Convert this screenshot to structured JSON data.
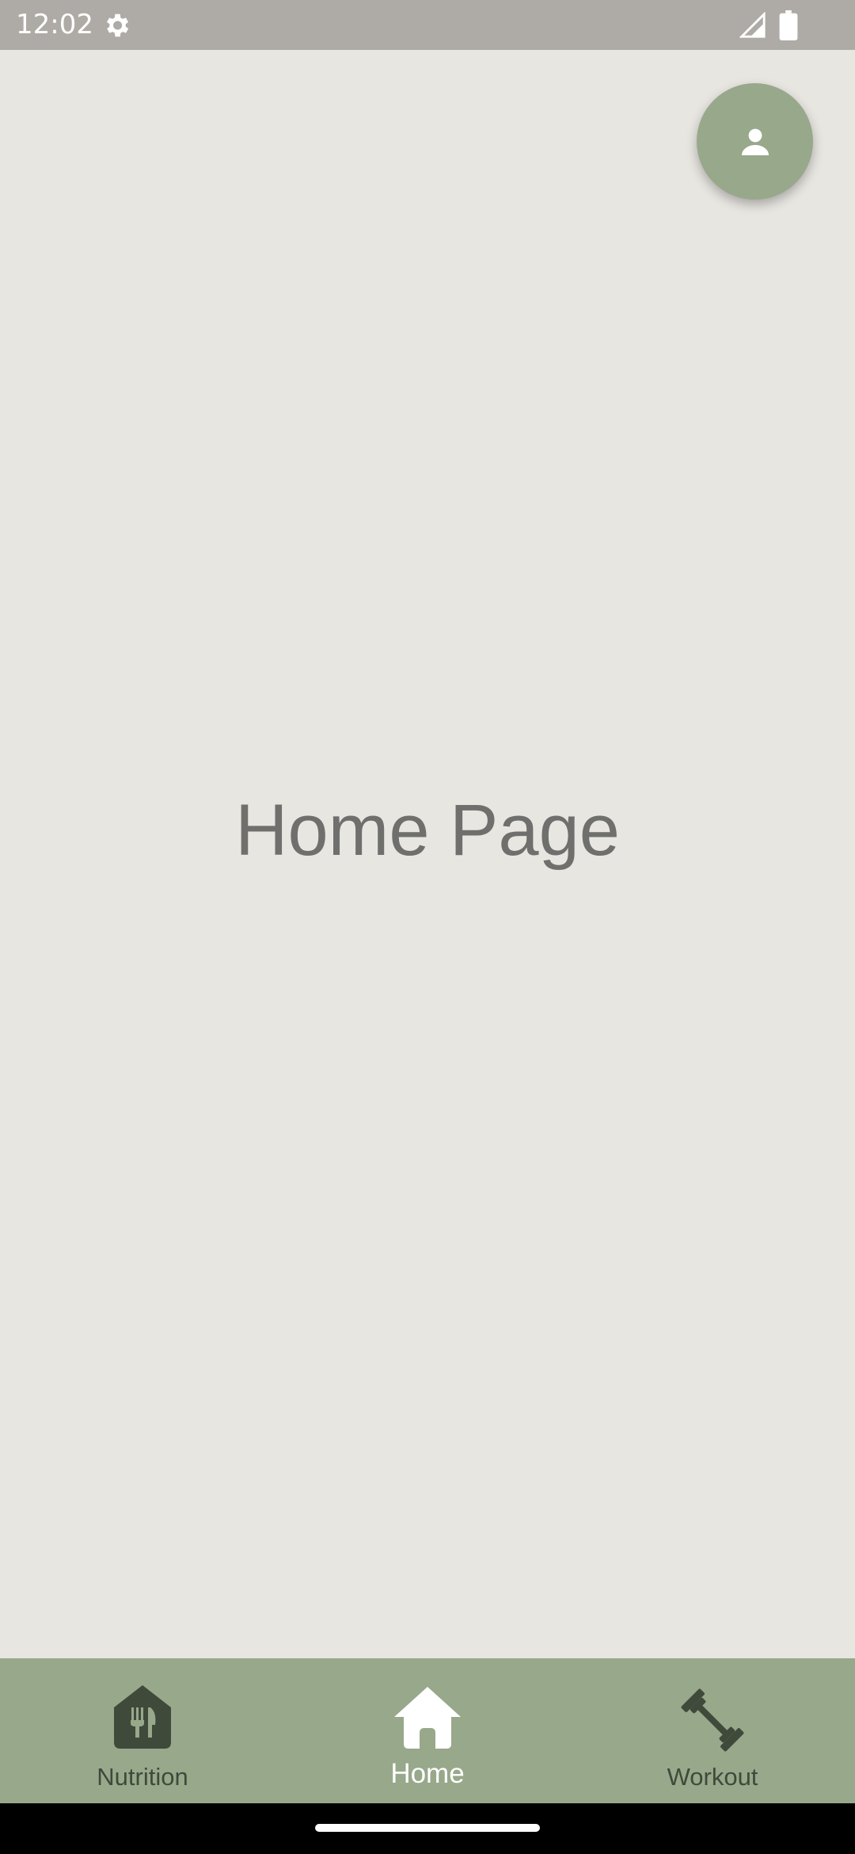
{
  "status_bar": {
    "time": "12:02",
    "settings_icon": "gear-icon",
    "signal_icon": "cell-signal-icon",
    "battery_icon": "battery-icon"
  },
  "main": {
    "title": "Home Page"
  },
  "profile_button": {
    "icon": "person-icon",
    "color": "#98a88b"
  },
  "bottom_nav": {
    "color": "#98a88b",
    "items": [
      {
        "label": "Nutrition",
        "icon": "restaurant-icon",
        "active": false
      },
      {
        "label": "Home",
        "icon": "home-icon",
        "active": true
      },
      {
        "label": "Workout",
        "icon": "dumbbell-icon",
        "active": false
      }
    ]
  },
  "colors": {
    "background": "#e8e6e1",
    "status_bar": "#aeaba6",
    "nav_inactive": "#3f4a3b",
    "nav_active": "#ffffff"
  }
}
